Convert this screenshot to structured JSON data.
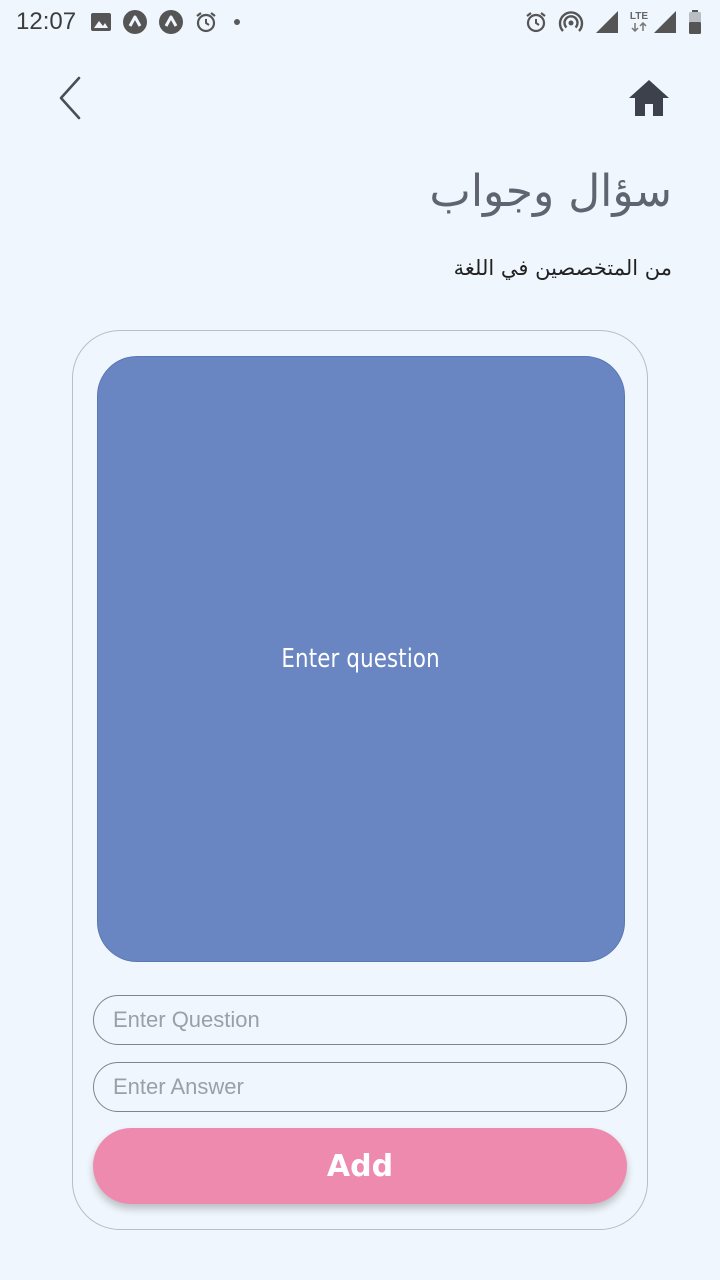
{
  "status_bar": {
    "time": "12:07",
    "left_icons": [
      "image-icon",
      "app-a-icon",
      "app-a-icon",
      "alarm-icon",
      "dot-icon"
    ],
    "network_label": "LTE",
    "right_icons": [
      "alarm-icon",
      "hotspot-icon",
      "signal-icon",
      "lte-signal-icon",
      "battery-icon"
    ]
  },
  "nav": {
    "back_icon": "chevron-left-icon",
    "home_icon": "home-icon"
  },
  "header": {
    "title": "سؤال وجواب",
    "subtitle": "من المتخصصين في اللغة"
  },
  "card": {
    "display_text": "Enter question",
    "question_placeholder": "Enter Question",
    "answer_placeholder": "Enter Answer",
    "add_label": "Add"
  },
  "colors": {
    "background": "#f0f6fd",
    "display_card": "#6986c2",
    "add_button": "#ed8aad",
    "icon_dark": "#3d414b"
  }
}
